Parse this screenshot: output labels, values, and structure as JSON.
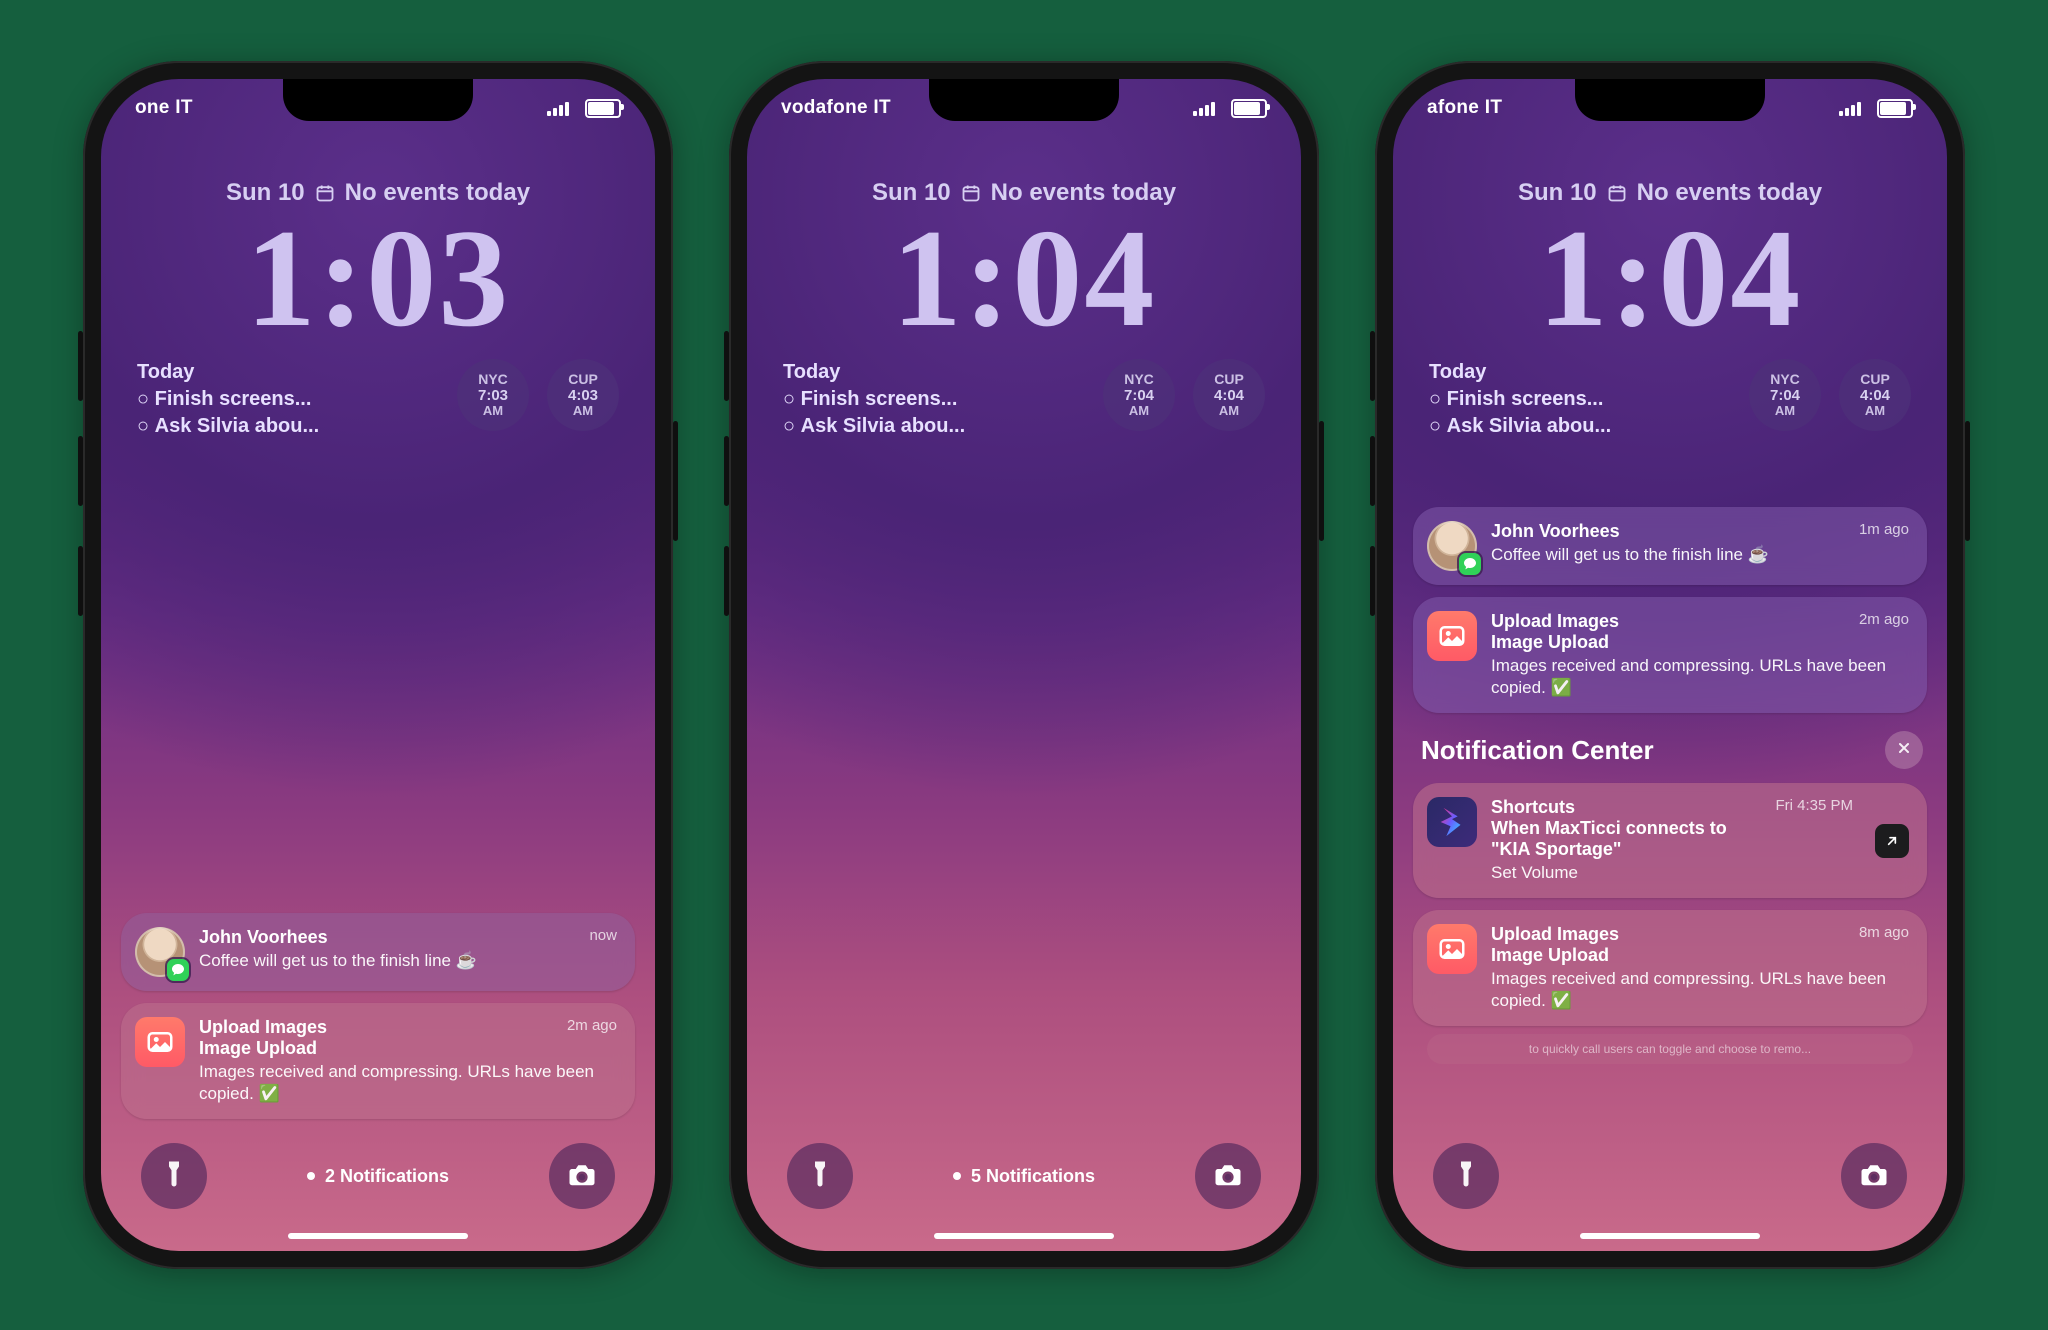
{
  "phones": [
    {
      "carrier": "one IT",
      "date": "Sun 10",
      "dateEvents": "No events today",
      "time": "1:03",
      "reminders": {
        "title": "Today",
        "items": [
          "Finish screens...",
          "Ask Silvia abou..."
        ]
      },
      "clocks": [
        {
          "city": "NYC",
          "time": "7:03",
          "ampm": "AM"
        },
        {
          "city": "CUP",
          "time": "4:03",
          "ampm": "AM"
        }
      ],
      "notifCountLabel": "2 Notifications",
      "stackBottom": 132,
      "cards": [
        {
          "kind": "message",
          "style": "card",
          "sender": "John Voorhees",
          "when": "now",
          "text": "Coffee will get us to the finish line ☕️"
        },
        {
          "kind": "app",
          "style": "card pinkish",
          "iconClass": "icon-photo",
          "appLine1": "Upload Images",
          "appLine2": "Image Upload",
          "when": "2m ago",
          "text": "Images received and compressing. URLs have been copied. ✅"
        }
      ]
    },
    {
      "carrier": "vodafone IT",
      "date": "Sun 10",
      "dateEvents": "No events today",
      "time": "1:04",
      "reminders": {
        "title": "Today",
        "items": [
          "Finish screens...",
          "Ask Silvia abou..."
        ]
      },
      "clocks": [
        {
          "city": "NYC",
          "time": "7:04",
          "ampm": "AM"
        },
        {
          "city": "CUP",
          "time": "4:04",
          "ampm": "AM"
        }
      ],
      "notifCountLabel": "5 Notifications",
      "stackBottom": 132,
      "cards": []
    },
    {
      "carrier": "afone IT",
      "date": "Sun 10",
      "dateEvents": "No events today",
      "time": "1:04",
      "reminders": {
        "title": "Today",
        "items": [
          "Finish screens...",
          "Ask Silvia abou..."
        ]
      },
      "clocks": [
        {
          "city": "NYC",
          "time": "7:04",
          "ampm": "AM"
        },
        {
          "city": "CUP",
          "time": "4:04",
          "ampm": "AM"
        }
      ],
      "notifCountLabel": "",
      "stackTop": 428,
      "ncTitle": "Notification Center",
      "cards": [
        {
          "kind": "message",
          "style": "card purplish",
          "sender": "John Voorhees",
          "when": "1m ago",
          "text": "Coffee will get us to the finish line ☕️"
        },
        {
          "kind": "app",
          "style": "card purplish",
          "iconClass": "icon-photo",
          "appLine1": "Upload Images",
          "appLine2": "Image Upload",
          "when": "2m ago",
          "text": "Images received and compressing. URLs have been copied. ✅"
        },
        {
          "kind": "nc-header"
        },
        {
          "kind": "app",
          "style": "card pinkish",
          "iconClass": "icon-shortcuts",
          "appLine1": "Shortcuts",
          "appLine2": "When MaxTicci connects to \"KIA Sportage\"",
          "when": "Fri 4:35 PM",
          "text": "Set Volume",
          "openBadge": true
        },
        {
          "kind": "app",
          "style": "card pinkish",
          "iconClass": "icon-photo",
          "appLine1": "Upload Images",
          "appLine2": "Image Upload",
          "when": "8m ago",
          "text": "Images received and compressing. URLs have been copied. ✅"
        },
        {
          "kind": "ghost",
          "text": "to quickly call users can toggle and choose to remo..."
        }
      ]
    }
  ],
  "icons": {
    "calendar": "<svg viewBox='0 0 24 24' fill='none' stroke='currentColor' stroke-width='2.2'><rect x='3' y='5' width='18' height='16' rx='3'/><path d='M3 10h18M8 3v4M16 3v4'/></svg>",
    "wifi": "<svg viewBox='0 0 24 18' fill='#fff'><path d='M12 17.5a2 2 0 100-4 2 2 0 000 4zm-5.4-5.9a8 8 0 0110.8 0l2.3-2.3a11.3 11.3 0 00-15.4 0l2.3 2.3zM1 6.1a15.6 15.6 0 0122 0l-2.3 2.3a12.3 12.3 0 00-17.4 0L1 6.1z'/></svg>",
    "photo": "<svg viewBox='0 0 24 24' fill='#fff'><rect x='3' y='5' width='18' height='14' rx='3' fill='none' stroke='#fff' stroke-width='2'/><circle cx='9' cy='10' r='2'/><path d='M4 18l5-5 3 3 4-4 4 4v2H4z'/></svg>",
    "shortcuts": "<svg viewBox='0 0 24 24'><defs><linearGradient id='sg' x1='0' x2='1' y1='0' y2='1'><stop offset='0' stop-color='#ff2d78'/><stop offset='.5' stop-color='#6a5cff'/><stop offset='1' stop-color='#2bd8ff'/></linearGradient></defs><path fill='url(#sg)' d='M6 2l10 6-4 2 6 4-10 8 3-7-7-3 8-4-6-6z'/></svg>",
    "open": "<svg viewBox='0 0 24 24' fill='none' stroke-width='2.5' stroke-linecap='round'><path d='M7 17L17 7M9 7h8v8'/></svg>",
    "close": "<svg viewBox='0 0 24 24' fill='none' stroke-width='3' stroke-linecap='round'><path d='M6 6l12 12M18 6L6 18'/></svg>",
    "flashlight": "<svg viewBox='0 0 24 24' fill='#fff'><path d='M8 2h8v4l-2 3v11a2 2 0 01-4 0V9L8 6V2zm3 10h2v3h-2z' opacity='.95'/></svg>",
    "camera": "<svg viewBox='0 0 24 24' fill='#fff'><path d='M4 8h3l2-3h6l2 3h3a2 2 0 012 2v9a2 2 0 01-2 2H4a2 2 0 01-2-2v-9a2 2 0 012-2zm8 11a4.5 4.5 0 100-9 4.5 4.5 0 000 9z' fill='#fff'/><circle cx='12' cy='14.5' r='2.6' fill='rgba(90,45,95,.9)'/></svg>",
    "msgbubble": "<svg viewBox='0 0 24 24' fill='#fff'><path d='M12 3c5 0 9 3.4 9 7.5S17 18 12 18c-1 0-1.9-.1-2.8-.4L5 20l1.2-3.8C4.3 14.8 3 12.8 3 10.5 3 6.4 7 3 12 3z'/></svg>"
  }
}
